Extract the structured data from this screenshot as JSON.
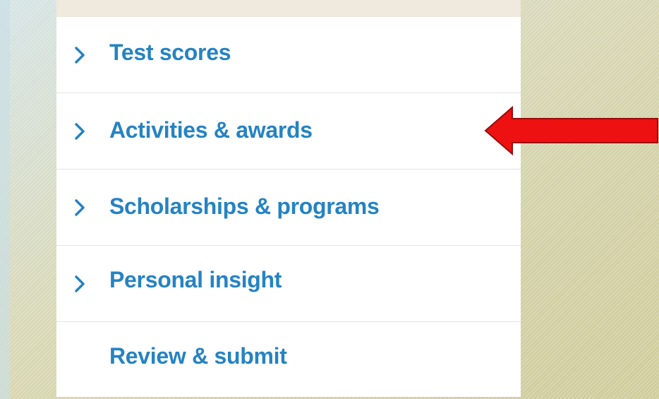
{
  "nav": {
    "items": [
      {
        "label": "Test scores",
        "icon": "chevron-right-icon",
        "has_chevron": true
      },
      {
        "label": "Activities & awards",
        "icon": "chevron-right-icon",
        "has_chevron": true
      },
      {
        "label": "Scholarships & programs",
        "icon": "chevron-right-icon",
        "has_chevron": true
      },
      {
        "label": "Personal insight",
        "icon": "chevron-right-icon",
        "has_chevron": true
      },
      {
        "label": "Review & submit",
        "has_chevron": false
      }
    ]
  },
  "annotation": {
    "icon": "red-arrow-pointer-icon",
    "color": "#ee1111",
    "points_to": "Activities & awards"
  },
  "colors": {
    "link_text": "#2583c2",
    "panel_bg": "#ffffff",
    "divider": "#e3e3e3"
  }
}
